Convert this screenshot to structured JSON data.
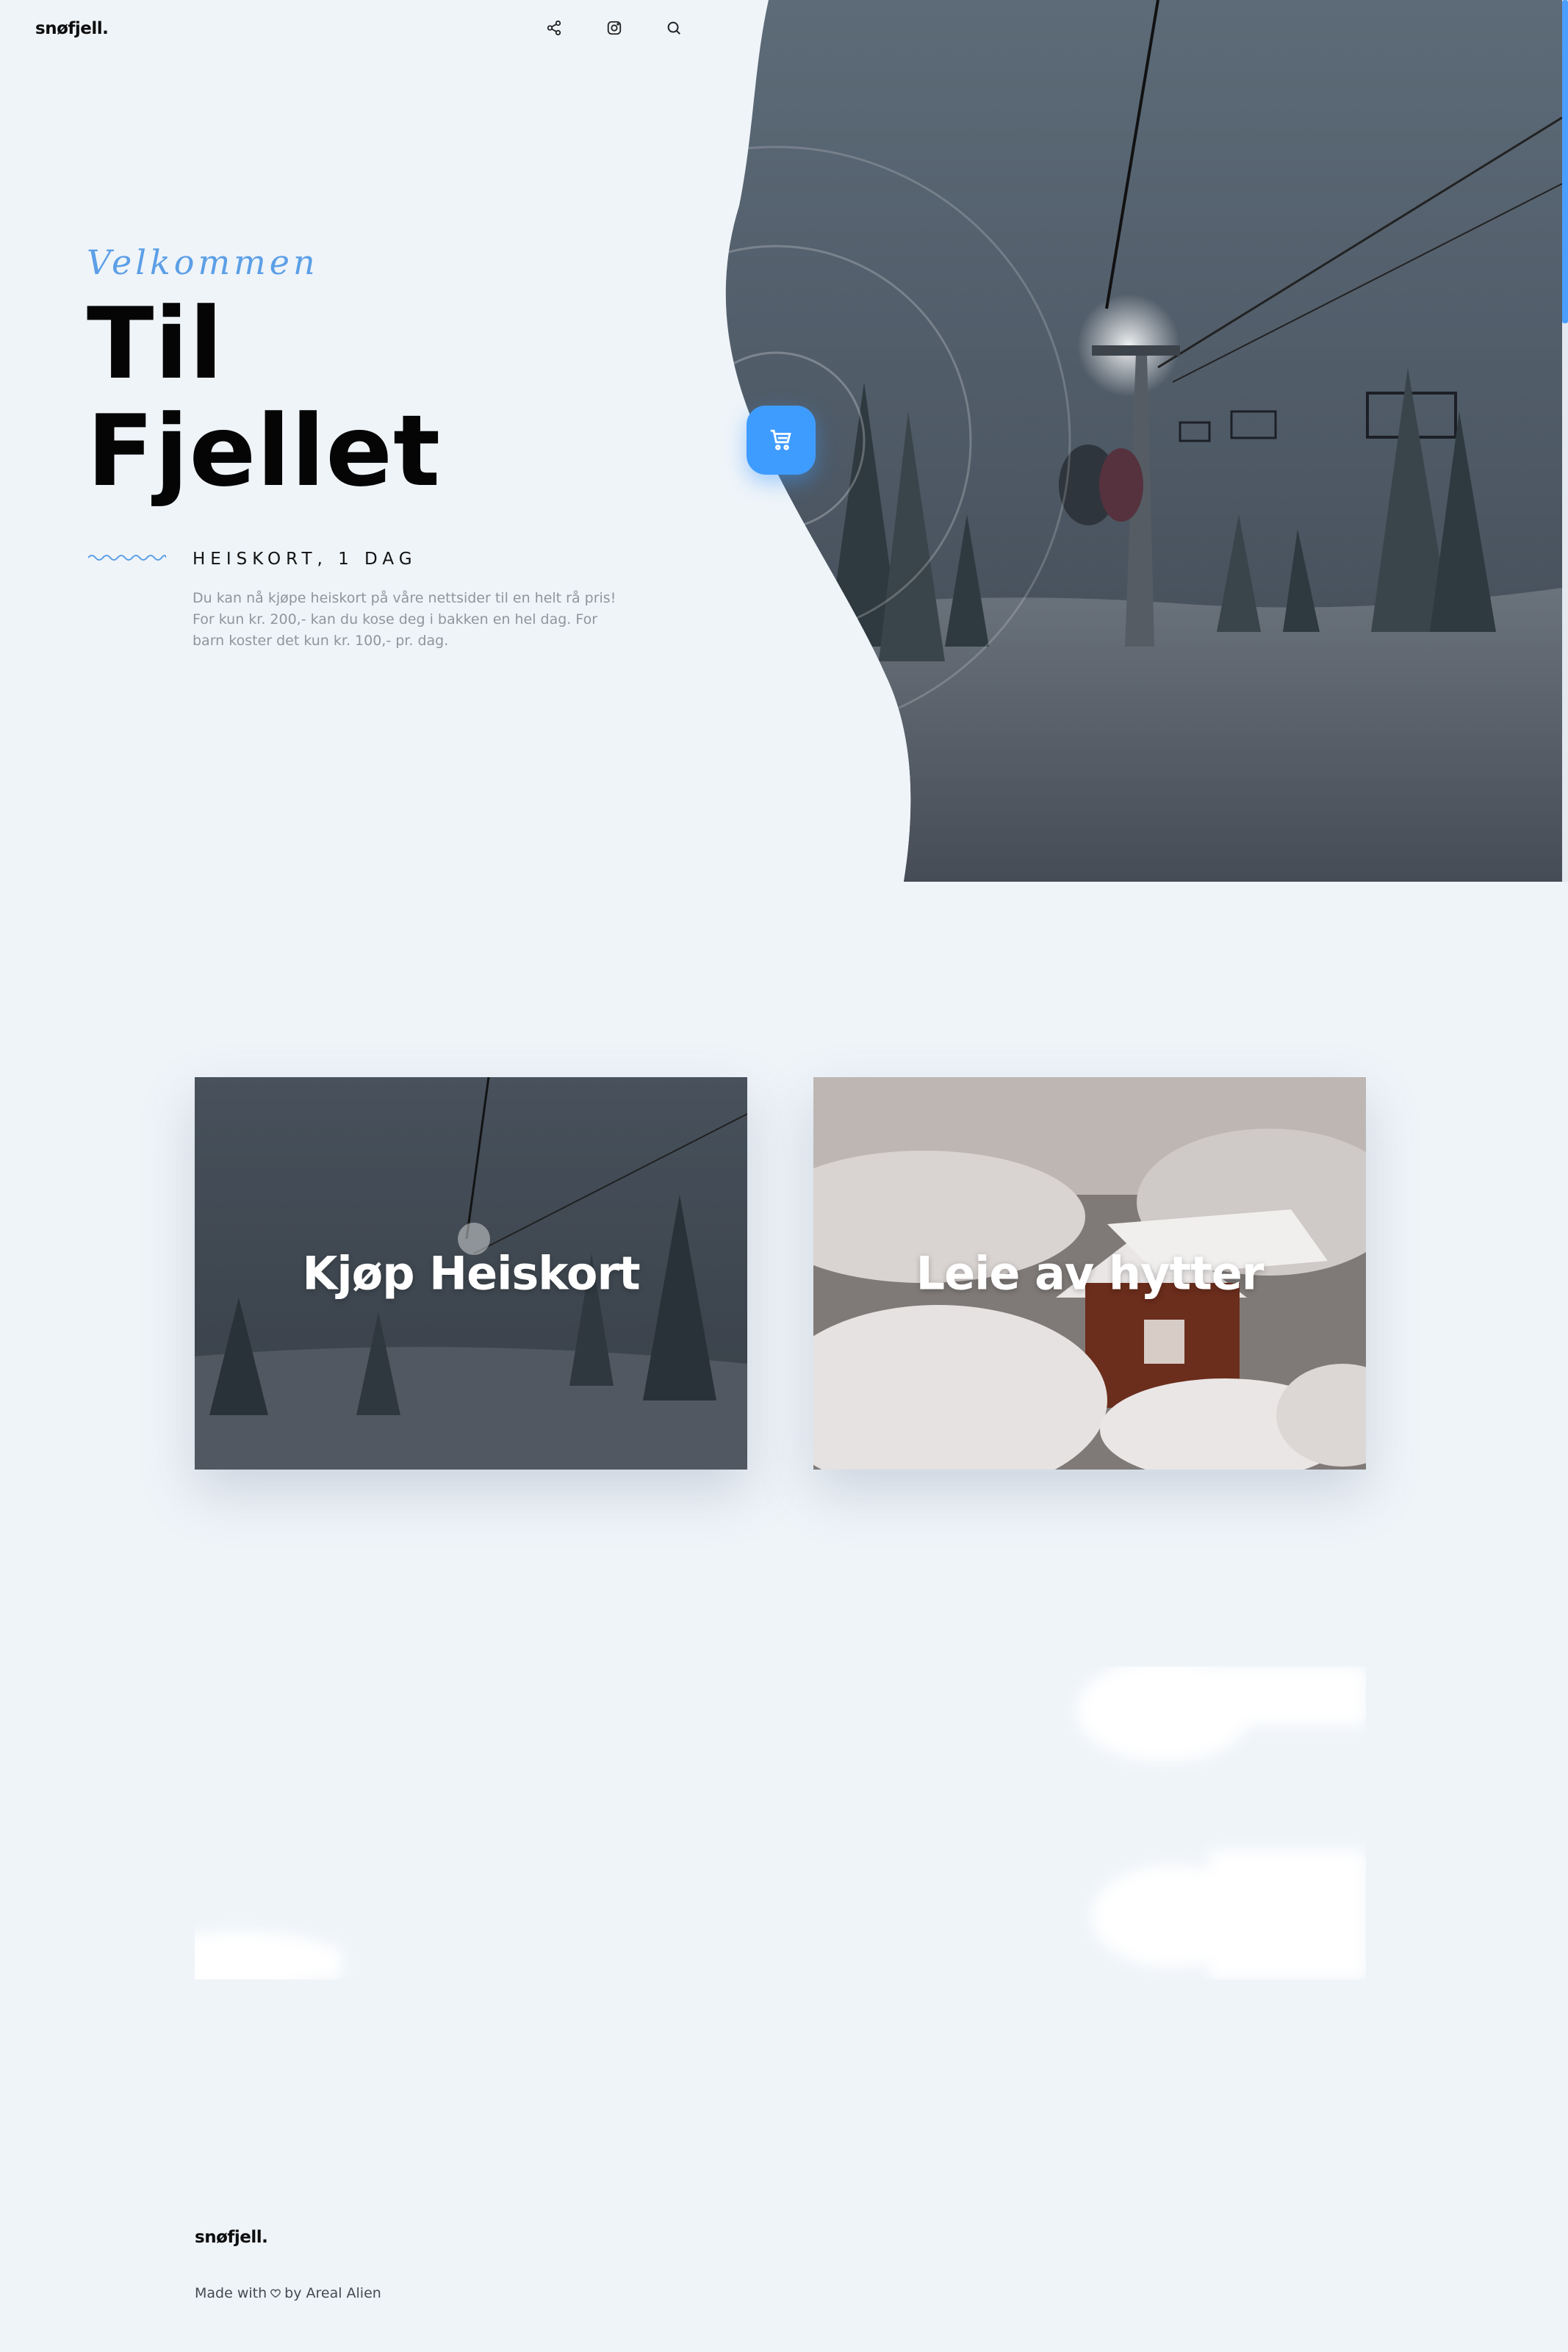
{
  "header": {
    "logo": "snøfjell.",
    "icons": [
      "share-icon",
      "instagram-icon",
      "search-icon"
    ]
  },
  "hero": {
    "welcome": "Velkommen",
    "title_line1": "Til",
    "title_line2": "Fjellet",
    "subtitle": "HEISKORT, 1 DAG",
    "description": "Du kan nå kjøpe heiskort på våre nettsider til en helt rå pris! For kun kr. 200,- kan du kose deg i bakken en hel dag. For barn koster det kun kr. 100,- pr. dag.",
    "cart_icon": "cart-icon"
  },
  "cards": [
    {
      "label": "Kjøp Heiskort"
    },
    {
      "label": "Leie av hytter"
    }
  ],
  "footer": {
    "logo": "snøfjell.",
    "credit_prefix": "Made with",
    "credit_suffix": "by Areal Alien",
    "heart_icon": "heart-icon"
  },
  "colors": {
    "background": "#eff4f9",
    "accent": "#3f9cff",
    "script": "#5b9fe6",
    "text": "#050505",
    "muted": "#8f959c"
  }
}
